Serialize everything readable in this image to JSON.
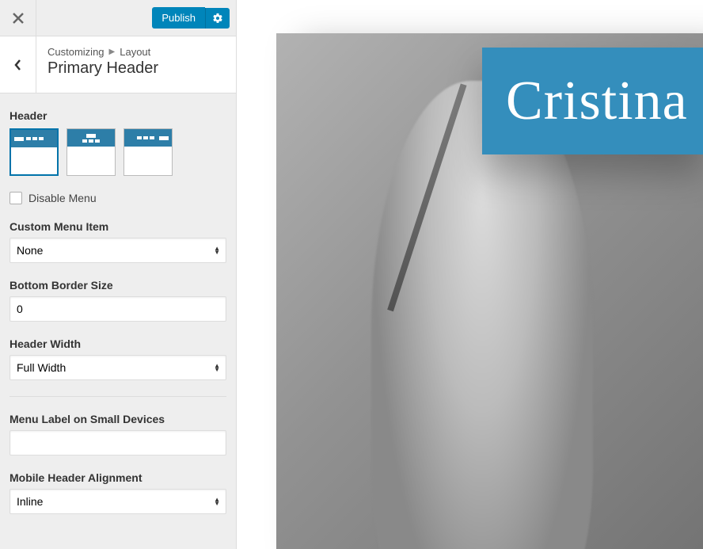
{
  "topbar": {
    "publish_label": "Publish"
  },
  "breadcrumb": {
    "root": "Customizing",
    "section": "Layout"
  },
  "section_title": "Primary Header",
  "labels": {
    "header": "Header",
    "disable_menu": "Disable Menu",
    "custom_menu_item": "Custom Menu Item",
    "bottom_border_size": "Bottom Border Size",
    "header_width": "Header Width",
    "menu_label_small": "Menu Label on Small Devices",
    "mobile_header_alignment": "Mobile Header Alignment"
  },
  "values": {
    "custom_menu_item": "None",
    "bottom_border_size": "0",
    "header_width": "Full Width",
    "menu_label_small": "",
    "mobile_header_alignment": "Inline",
    "disable_menu_checked": false
  },
  "header_layout_selected_index": 0,
  "colors": {
    "accent": "#0085ba",
    "preview_title_bg": "#348ebc"
  },
  "preview": {
    "title": "Cristina"
  }
}
